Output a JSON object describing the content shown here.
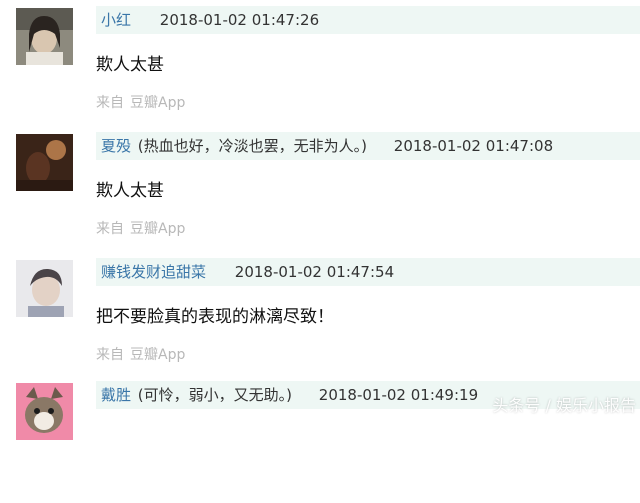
{
  "comments": [
    {
      "username": "小红",
      "note": "",
      "time": "2018-01-02 01:47:26",
      "text": "欺人太甚",
      "source_label": "来自",
      "source_app": "豆瓣App"
    },
    {
      "username": "夏殁",
      "note": "(热血也好，冷淡也罢，无非为人。)",
      "time": "2018-01-02 01:47:08",
      "text": "欺人太甚",
      "source_label": "来自",
      "source_app": "豆瓣App"
    },
    {
      "username": "赚钱发财追甜菜",
      "note": "",
      "time": "2018-01-02 01:47:54",
      "text": "把不要脸真的表现的淋漓尽致！",
      "source_label": "来自",
      "source_app": "豆瓣App"
    },
    {
      "username": "戴胜",
      "note": "(可怜，弱小，又无助。)",
      "time": "2018-01-02 01:49:19",
      "text": "",
      "source_label": "",
      "source_app": ""
    }
  ],
  "watermark": "头条号 / 娱乐小报告",
  "colors": {
    "header_bg": "#eef7f4",
    "username": "#3a76a8",
    "source_text": "#b8b8b8"
  }
}
